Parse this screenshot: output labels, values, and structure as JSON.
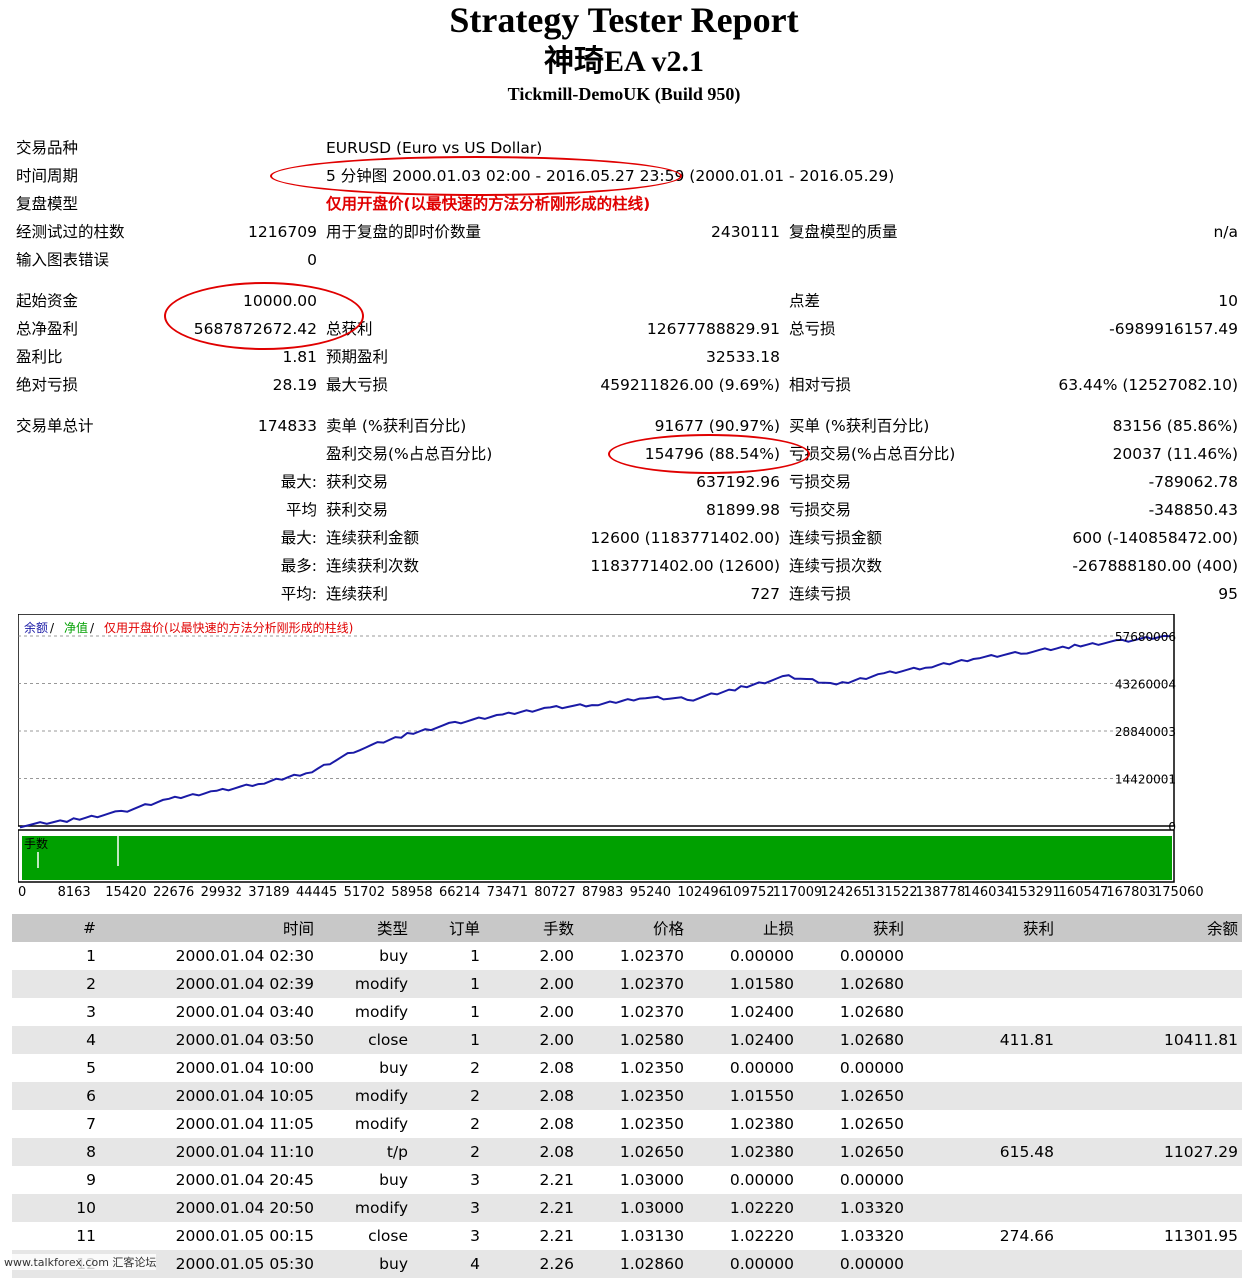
{
  "header": {
    "title": "Strategy Tester Report",
    "ea_name": "神琦EA v2.1",
    "server": "Tickmill-DemoUK (Build 950)"
  },
  "info": {
    "symbol_label": "交易品种",
    "symbol_value": "EURUSD (Euro vs US Dollar)",
    "period_label": "时间周期",
    "period_value": "5 分钟图 2000.01.03 02:00 - 2016.05.27 23:59 (2000.01.01 - 2016.05.29)",
    "model_label": "复盘模型",
    "model_value": "仅用开盘价(以最快速的方法分析刚形成的柱线)",
    "bars_label": "经测试过的柱数",
    "bars_value": "1216709",
    "ticks_label": "用于复盘的即时价数量",
    "ticks_value": "2430111",
    "quality_label": "复盘模型的质量",
    "quality_value": "n/a",
    "errors_label": "输入图表错误",
    "errors_value": "0"
  },
  "stats": {
    "deposit_label": "起始资金",
    "deposit_value": "10000.00",
    "spread_label": "点差",
    "spread_value": "10",
    "net_label": "总净盈利",
    "net_value": "5687872672.42",
    "gross_profit_label": "总获利",
    "gross_profit_value": "12677788829.91",
    "gross_loss_label": "总亏损",
    "gross_loss_value": "-6989916157.49",
    "pf_label": "盈利比",
    "pf_value": "1.81",
    "expected_label": "预期盈利",
    "expected_value": "32533.18",
    "abs_dd_label": "绝对亏损",
    "abs_dd_value": "28.19",
    "max_dd_label": "最大亏损",
    "max_dd_value": "459211826.00 (9.69%)",
    "rel_dd_label": "相对亏损",
    "rel_dd_value": "63.44% (12527082.10)",
    "total_label": "交易单总计",
    "total_value": "174833",
    "short_label": "卖单 (%获利百分比)",
    "short_value": "91677 (90.97%)",
    "long_label": "买单 (%获利百分比)",
    "long_value": "83156 (85.86%)",
    "profit_trades_label": "盈利交易(%占总百分比)",
    "profit_trades_value": "154796 (88.54%)",
    "loss_trades_label": "亏损交易(%占总百分比)",
    "loss_trades_value": "20037 (11.46%)",
    "largest_prefix": "最大:",
    "largest_profit_label": "获利交易",
    "largest_profit_value": "637192.96",
    "largest_loss_label": "亏损交易",
    "largest_loss_value": "-789062.78",
    "average_prefix": "平均",
    "average_profit_label": "获利交易",
    "average_profit_value": "81899.98",
    "average_loss_label": "亏损交易",
    "average_loss_value": "-348850.43",
    "max_consec_prefix": "最大:",
    "max_consec_win_label": "连续获利金额",
    "max_consec_win_value": "12600 (1183771402.00)",
    "max_consec_loss_label": "连续亏损金额",
    "max_consec_loss_value": "600 (-140858472.00)",
    "most_consec_prefix": "最多:",
    "most_consec_win_label": "连续获利次数",
    "most_consec_win_value": "1183771402.00 (12600)",
    "most_consec_loss_label": "连续亏损次数",
    "most_consec_loss_value": "-267888180.00 (400)",
    "avg_consec_prefix": "平均:",
    "avg_consec_win_label": "连续获利",
    "avg_consec_win_value": "727",
    "avg_consec_loss_label": "连续亏损",
    "avg_consec_loss_value": "95"
  },
  "chart_legend": {
    "balance": "余额",
    "sep1": " / ",
    "equity": "净值",
    "sep2": " / ",
    "model": "仅用开盘价(以最快速的方法分析刚形成的柱线)",
    "lots": "手数"
  },
  "chart_data": {
    "type": "line",
    "series": [
      {
        "name": "余额",
        "color": "#1a1aa6"
      }
    ],
    "x": [
      0,
      8163,
      15420,
      22676,
      29932,
      37189,
      44445,
      51702,
      58958,
      66214,
      73471,
      80727,
      87983,
      95240,
      102496,
      109752,
      117009,
      124265,
      131522,
      138778,
      146034,
      153291,
      160547,
      167803,
      175060
    ],
    "y": [
      0,
      1900000,
      4300000,
      8100000,
      10700000,
      13000000,
      16600000,
      23400000,
      27800000,
      31300000,
      33700000,
      36000000,
      36800000,
      39100000,
      38500000,
      42000000,
      45500000,
      42800000,
      46400000,
      48300000,
      51200000,
      52800000,
      54600000,
      56200000,
      57600000
    ],
    "x_ticks": [
      "0",
      "8163",
      "15420",
      "22676",
      "29932",
      "37189",
      "44445",
      "51702",
      "58958",
      "66214",
      "73471",
      "80727",
      "87983",
      "95240",
      "102496",
      "109752",
      "117009",
      "124265",
      "131522",
      "138778",
      "146034",
      "153291",
      "160547",
      "167803",
      "175060"
    ],
    "y_ticks": [
      "0",
      "14420001",
      "28840003",
      "43260004",
      "57680006"
    ],
    "ylim": [
      0,
      57680006
    ],
    "grid": true,
    "legend": "top-left",
    "lots_color": "#00a000"
  },
  "trades": {
    "headers": [
      "#",
      "时间",
      "类型",
      "订单",
      "手数",
      "价格",
      "止损",
      "获利",
      "获利",
      "余额"
    ],
    "rows": [
      [
        "1",
        "2000.01.04 02:30",
        "buy",
        "1",
        "2.00",
        "1.02370",
        "0.00000",
        "0.00000",
        "",
        ""
      ],
      [
        "2",
        "2000.01.04 02:39",
        "modify",
        "1",
        "2.00",
        "1.02370",
        "1.01580",
        "1.02680",
        "",
        ""
      ],
      [
        "3",
        "2000.01.04 03:40",
        "modify",
        "1",
        "2.00",
        "1.02370",
        "1.02400",
        "1.02680",
        "",
        ""
      ],
      [
        "4",
        "2000.01.04 03:50",
        "close",
        "1",
        "2.00",
        "1.02580",
        "1.02400",
        "1.02680",
        "411.81",
        "10411.81"
      ],
      [
        "5",
        "2000.01.04 10:00",
        "buy",
        "2",
        "2.08",
        "1.02350",
        "0.00000",
        "0.00000",
        "",
        ""
      ],
      [
        "6",
        "2000.01.04 10:05",
        "modify",
        "2",
        "2.08",
        "1.02350",
        "1.01550",
        "1.02650",
        "",
        ""
      ],
      [
        "7",
        "2000.01.04 11:05",
        "modify",
        "2",
        "2.08",
        "1.02350",
        "1.02380",
        "1.02650",
        "",
        ""
      ],
      [
        "8",
        "2000.01.04 11:10",
        "t/p",
        "2",
        "2.08",
        "1.02650",
        "1.02380",
        "1.02650",
        "615.48",
        "11027.29"
      ],
      [
        "9",
        "2000.01.04 20:45",
        "buy",
        "3",
        "2.21",
        "1.03000",
        "0.00000",
        "0.00000",
        "",
        ""
      ],
      [
        "10",
        "2000.01.04 20:50",
        "modify",
        "3",
        "2.21",
        "1.03000",
        "1.02220",
        "1.03320",
        "",
        ""
      ],
      [
        "11",
        "2000.01.05 00:15",
        "close",
        "3",
        "2.21",
        "1.03130",
        "1.02220",
        "1.03320",
        "274.66",
        "11301.95"
      ],
      [
        "12",
        "2000.01.05 05:30",
        "buy",
        "4",
        "2.26",
        "1.02860",
        "0.00000",
        "0.00000",
        "",
        ""
      ]
    ]
  },
  "watermark": "www.talkforex.com 汇客论坛"
}
